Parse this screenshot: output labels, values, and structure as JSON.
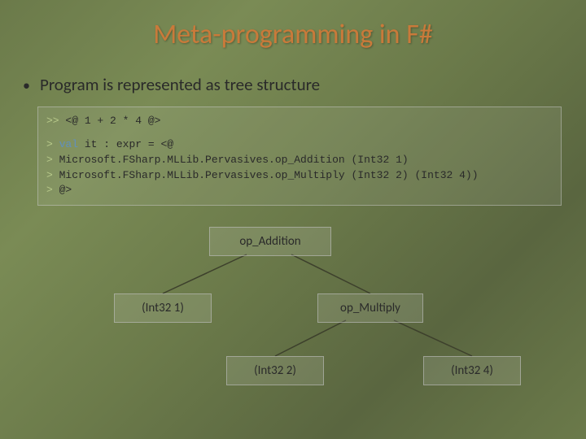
{
  "title": "Meta-programming in F#",
  "bullet": "Program is represented as tree structure",
  "code": {
    "line1_prompt": ">>",
    "line1_text": " <@ 1 + 2 * 4 @>",
    "l2_prompt": ">",
    "l2_kw": " val",
    "l2_rest": " it : expr = <@",
    "l3_prompt": ">",
    "l3_text": "    Microsoft.FSharp.MLLib.Pervasives.op_Addition (Int32 1)",
    "l4_prompt": ">",
    "l4_text": "      Microsoft.FSharp.MLLib.Pervasives.op_Multiply (Int32 2) (Int32 4))",
    "l5_prompt": ">",
    "l5_text": "  @>"
  },
  "tree": {
    "root": "op_Addition",
    "left": "(Int32 1)",
    "right": "op_Multiply",
    "rleft": "(Int32 2)",
    "rright": "(Int32 4)"
  }
}
